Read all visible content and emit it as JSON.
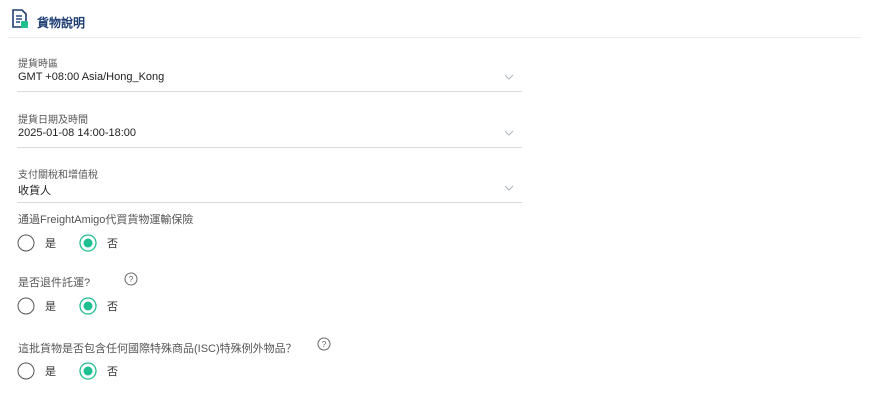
{
  "header": {
    "title": "貨物說明",
    "icon": "document-icon"
  },
  "fields": {
    "timezone": {
      "label": "提貨時區",
      "value": "GMT +08:00 Asia/Hong_Kong"
    },
    "pickup_datetime": {
      "label": "提貨日期及時間",
      "value": "2025-01-08 14:00-18:00"
    },
    "duties_taxes": {
      "label": "支付關稅和增值稅",
      "value": "收貨人"
    }
  },
  "questions": {
    "insurance": {
      "text": "通過FreightAmigo代買貨物運輸保險",
      "yes": "是",
      "no": "否",
      "selected": "no"
    },
    "return_shipment": {
      "text": "是否退件託運?",
      "yes": "是",
      "no": "否",
      "selected": "no"
    },
    "isc_items": {
      "text": "這批貨物是否包含任何國際特殊商品(ISC)特殊例外物品？",
      "yes": "是",
      "no": "否",
      "selected": "no"
    }
  },
  "colors": {
    "accent": "#1fbf8f",
    "title": "#1f3f74",
    "icon_green": "#1fbf8f",
    "icon_navy": "#1f3f74"
  }
}
